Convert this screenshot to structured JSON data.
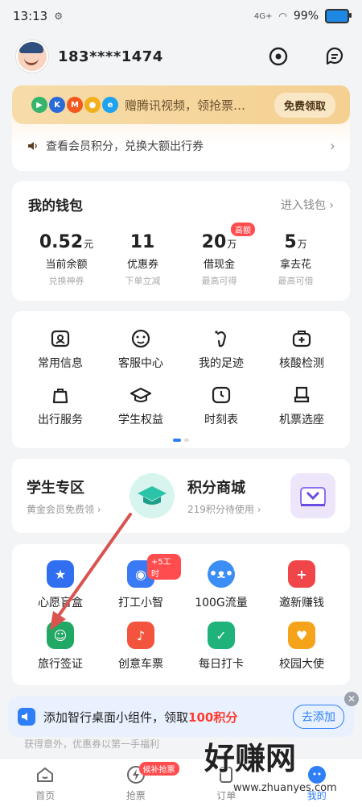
{
  "status": {
    "time": "13:13",
    "network": "4G+",
    "battery": "99%"
  },
  "header": {
    "phone": "183****1474"
  },
  "promo": {
    "text": "赠腾讯视频，领抢票…",
    "button": "免费领取",
    "notice": "查看会员积分，兑换大额出行券"
  },
  "wallet": {
    "title": "我的钱包",
    "enter": "进入钱包",
    "items": [
      {
        "num": "0.52",
        "unit": "元",
        "label": "当前余额",
        "sub": "兑换神券"
      },
      {
        "num": "11",
        "unit": "",
        "label": "优惠券",
        "sub": "下单立减"
      },
      {
        "num": "20",
        "unit": "万",
        "label": "借现金",
        "sub": "最高可得",
        "badge": "高额"
      },
      {
        "num": "5",
        "unit": "万",
        "label": "拿去花",
        "sub": "最高可借"
      }
    ]
  },
  "services": [
    {
      "label": "常用信息",
      "icon": "id-card-icon"
    },
    {
      "label": "客服中心",
      "icon": "headset-icon"
    },
    {
      "label": "我的足迹",
      "icon": "footprint-icon"
    },
    {
      "label": "核酸检测",
      "icon": "medical-kit-icon"
    },
    {
      "label": "出行服务",
      "icon": "bag-icon"
    },
    {
      "label": "学生权益",
      "icon": "graduation-cap-icon"
    },
    {
      "label": "时刻表",
      "icon": "clock-icon"
    },
    {
      "label": "机票选座",
      "icon": "seat-icon"
    }
  ],
  "zones": [
    {
      "title": "学生专区",
      "sub": "黄金会员免费领"
    },
    {
      "title": "积分商城",
      "sub": "219积分待使用"
    }
  ],
  "features": [
    {
      "label": "心愿盲盒",
      "icon": "gift-box-icon",
      "color": "#2f6ff0"
    },
    {
      "label": "打工小智",
      "icon": "robot-icon",
      "color": "#3a7bf5",
      "badge": "+5工时"
    },
    {
      "label": "100G流量",
      "icon": "bear-icon",
      "color": "#3b8ef5"
    },
    {
      "label": "邀新赚钱",
      "icon": "red-envelope-icon",
      "color": "#f0464a"
    },
    {
      "label": "旅行签证",
      "icon": "passport-icon",
      "color": "#22a865"
    },
    {
      "label": "创意车票",
      "icon": "ticket-icon",
      "color": "#f2543d"
    },
    {
      "label": "每日打卡",
      "icon": "checkin-icon",
      "color": "#1fb37a"
    },
    {
      "label": "校园大使",
      "icon": "medal-icon",
      "color": "#f5a31a"
    }
  ],
  "banner": {
    "text_pre": "添加智行桌面小组件，领取",
    "text_hl": "100积分",
    "button": "去添加",
    "faded": "获得意外，优惠券以第一手福利"
  },
  "tabs": [
    {
      "label": "首页",
      "icon": "home-icon"
    },
    {
      "label": "抢票",
      "icon": "lightning-icon",
      "badge": "候补抢票"
    },
    {
      "label": "订单",
      "icon": "order-icon"
    },
    {
      "label": "我的",
      "icon": "profile-icon"
    }
  ],
  "watermark": {
    "text": "好赚网",
    "url": "www.zhuanyes.com"
  },
  "colors": {
    "accent": "#2d7ef7",
    "badge": "#ff4d4f",
    "annotation_arrow": "#d9534f"
  }
}
